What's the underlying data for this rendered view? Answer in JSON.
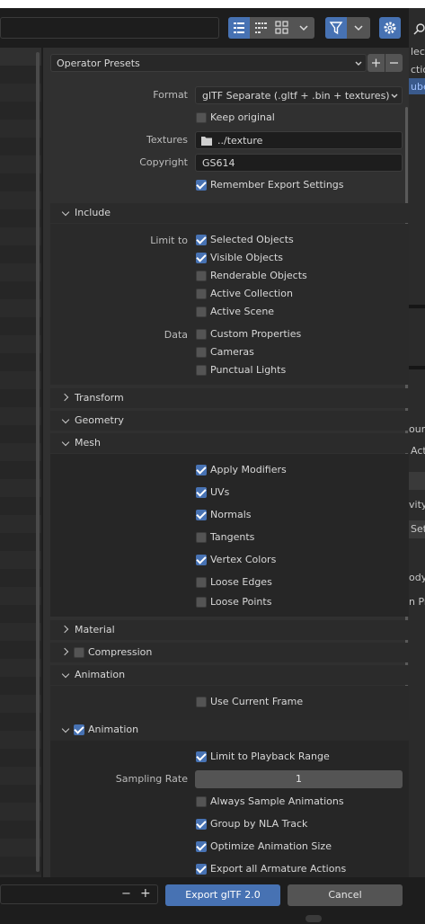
{
  "toolbar": {
    "view_buttons": [
      "vertical-list-icon",
      "horizontal-list-icon",
      "thumbnails-icon"
    ],
    "filter_icon": "funnel-icon",
    "settings_icon": "gear-icon"
  },
  "presets": {
    "label": "Operator Presets"
  },
  "format": {
    "label": "Format",
    "value": "glTF Separate (.gltf + .bin + textures)"
  },
  "keep_original": {
    "label": "Keep original",
    "checked": false
  },
  "textures": {
    "label": "Textures",
    "value": "../texture"
  },
  "copyright": {
    "label": "Copyright",
    "value": "GS614"
  },
  "remember": {
    "label": "Remember Export Settings",
    "checked": true
  },
  "sections": {
    "include": "Include",
    "transform": "Transform",
    "geometry": "Geometry",
    "mesh": "Mesh",
    "material": "Material",
    "compression": "Compression",
    "animation": "Animation",
    "animation_sub": "Animation"
  },
  "include": {
    "limit_to_label": "Limit to",
    "data_label": "Data",
    "selected_objects": "Selected Objects",
    "visible_objects": "Visible Objects",
    "renderable_objects": "Renderable Objects",
    "active_collection": "Active Collection",
    "active_scene": "Active Scene",
    "custom_properties": "Custom Properties",
    "cameras": "Cameras",
    "punctual_lights": "Punctual Lights"
  },
  "mesh": {
    "apply_modifiers": "Apply Modifiers",
    "uvs": "UVs",
    "normals": "Normals",
    "tangents": "Tangents",
    "vertex_colors": "Vertex Colors",
    "loose_edges": "Loose Edges",
    "loose_points": "Loose Points"
  },
  "animation": {
    "use_current_frame": "Use Current Frame",
    "limit_playback": "Limit to Playback Range",
    "sampling_rate_label": "Sampling Rate",
    "sampling_rate_value": "1",
    "always_sample": "Always Sample Animations",
    "group_nla": "Group by NLA Track",
    "optimize_size": "Optimize Animation Size",
    "export_armature": "Export all Armature Actions"
  },
  "footer": {
    "export_button": "Export glTF 2.0",
    "cancel_button": "Cancel",
    "minus": "−",
    "plus": "+"
  },
  "side_panel": {
    "fragments": [
      "lect",
      "ctio",
      "ube",
      "oun",
      "Act",
      "vity",
      "Set",
      "ody",
      "n Pr"
    ]
  },
  "colors": {
    "accent": "#4772b3",
    "panel": "#303030",
    "background": "#1d1d1d"
  }
}
